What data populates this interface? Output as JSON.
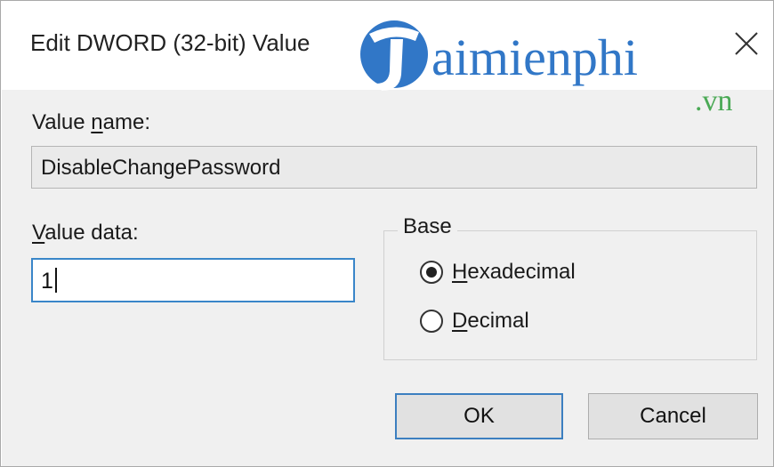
{
  "dialog": {
    "title": "Edit DWORD (32-bit) Value",
    "close_icon": "close-x-icon"
  },
  "value_name": {
    "label_prefix": "Value ",
    "label_accel": "n",
    "label_suffix": "ame:",
    "value": "DisableChangePassword"
  },
  "value_data": {
    "label_accel": "V",
    "label_suffix": "alue data:",
    "value": "1"
  },
  "base": {
    "legend": "Base",
    "options": [
      {
        "accel": "H",
        "rest": "exadecimal",
        "selected": true
      },
      {
        "accel": "D",
        "rest": "ecimal",
        "selected": false
      }
    ]
  },
  "buttons": {
    "ok": "OK",
    "cancel": "Cancel"
  },
  "watermark": {
    "brand": "aimienphi",
    "suffix": ".vn",
    "colors": {
      "blue": "#1565c0",
      "green": "#2e9d3a"
    }
  }
}
